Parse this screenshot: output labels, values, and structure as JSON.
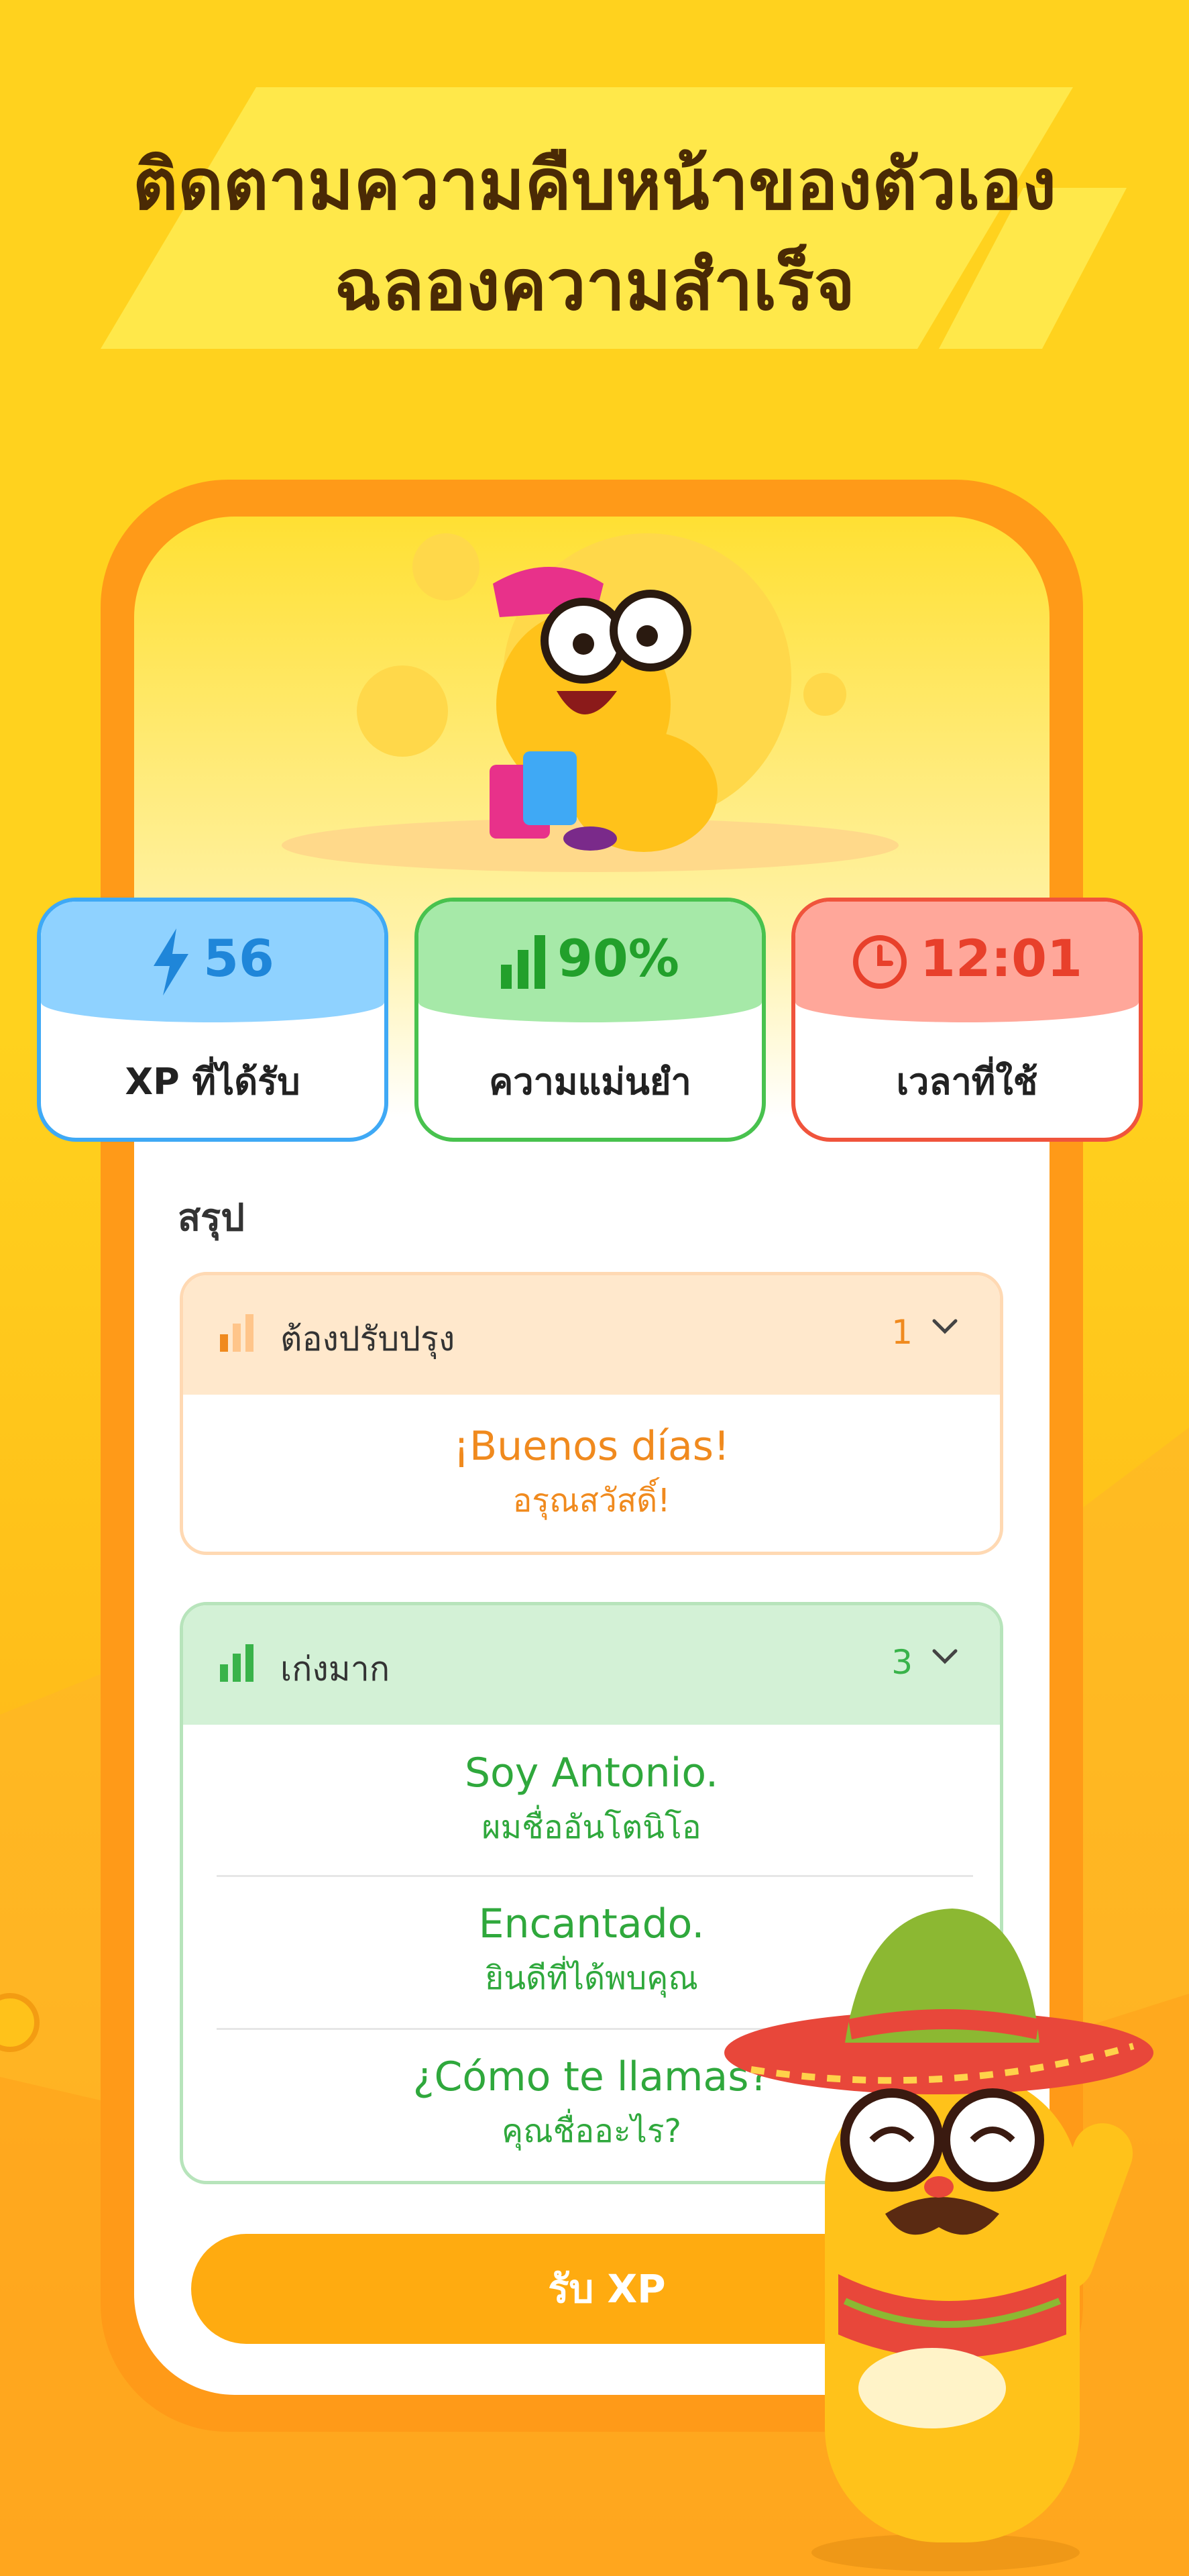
{
  "headline": {
    "line1": "ติดตามความคืบหน้าของตัวเอง",
    "line2": "ฉลองความสำเร็จ"
  },
  "stats": [
    {
      "value": "56",
      "label": "XP ที่ได้รับ",
      "icon": "lightning-icon",
      "color": "#1f86d9"
    },
    {
      "value": "90%",
      "label": "ความแม่นยำ",
      "icon": "signal-bars-icon",
      "color": "#22a02b"
    },
    {
      "value": "12:01",
      "label": "เวลาที่ใช้",
      "icon": "clock-icon",
      "color": "#e8402b"
    }
  ],
  "summary": {
    "title": "สรุป",
    "needs_improvement": {
      "title": "ต้องปรับปรุง",
      "count": "1",
      "items": [
        {
          "phrase": "¡Buenos días!",
          "translation": "อรุณสวัสดิ์!"
        }
      ]
    },
    "excellent": {
      "title": "เก่งมาก",
      "count": "3",
      "items": [
        {
          "phrase": "Soy Antonio.",
          "translation": "ผมชื่ออันโตนิโอ"
        },
        {
          "phrase": "Encantado.",
          "translation": "ยินดีที่ได้พบคุณ"
        },
        {
          "phrase": "¿Cómo te llamas?",
          "translation": "คุณชื่ออะไร?"
        }
      ]
    }
  },
  "cta": {
    "label": "รับ XP"
  },
  "colors": {
    "accent": "#ffab10",
    "phone_frame": "#ff9a18",
    "headline": "#4a2a05"
  }
}
